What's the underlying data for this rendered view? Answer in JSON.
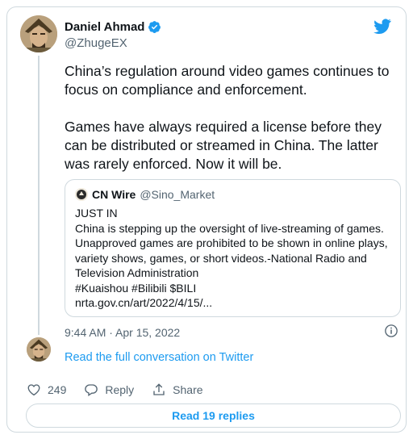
{
  "author": {
    "display_name": "Daniel Ahmad",
    "handle": "@ZhugeEX"
  },
  "tweet": {
    "paragraphs": [
      "China’s regulation around video games continues to focus on compliance and enforcement.",
      "Games have always required a license before they can be distributed or streamed in China. The latter was rarely enforced. Now it will be."
    ],
    "timestamp": "9:44 AM · Apr 15, 2022"
  },
  "quoted": {
    "name": "CN Wire",
    "handle": "@Sino_Market",
    "lines": [
      "JUST IN",
      "China is stepping up the oversight of live-streaming of games.",
      "Unapproved games are prohibited to be shown in online plays,",
      "variety shows, games, or short videos.-National Radio and",
      "Television Administration",
      "#Kuaishou #Bilibili $BILI",
      "nrta.gov.cn/art/2022/4/15/..."
    ]
  },
  "read_full_link": "Read the full conversation on Twitter",
  "actions": {
    "like_count": "249",
    "reply_label": "Reply",
    "share_label": "Share"
  },
  "read_replies_label": "Read 19 replies",
  "colors": {
    "accent": "#1d9bf0",
    "secondary_text": "#536471",
    "border": "#cfd9de",
    "primary_text": "#0f1419"
  },
  "icons": [
    "verified-badge-icon",
    "twitter-bird-icon",
    "info-icon",
    "heart-icon",
    "reply-icon",
    "share-icon"
  ]
}
